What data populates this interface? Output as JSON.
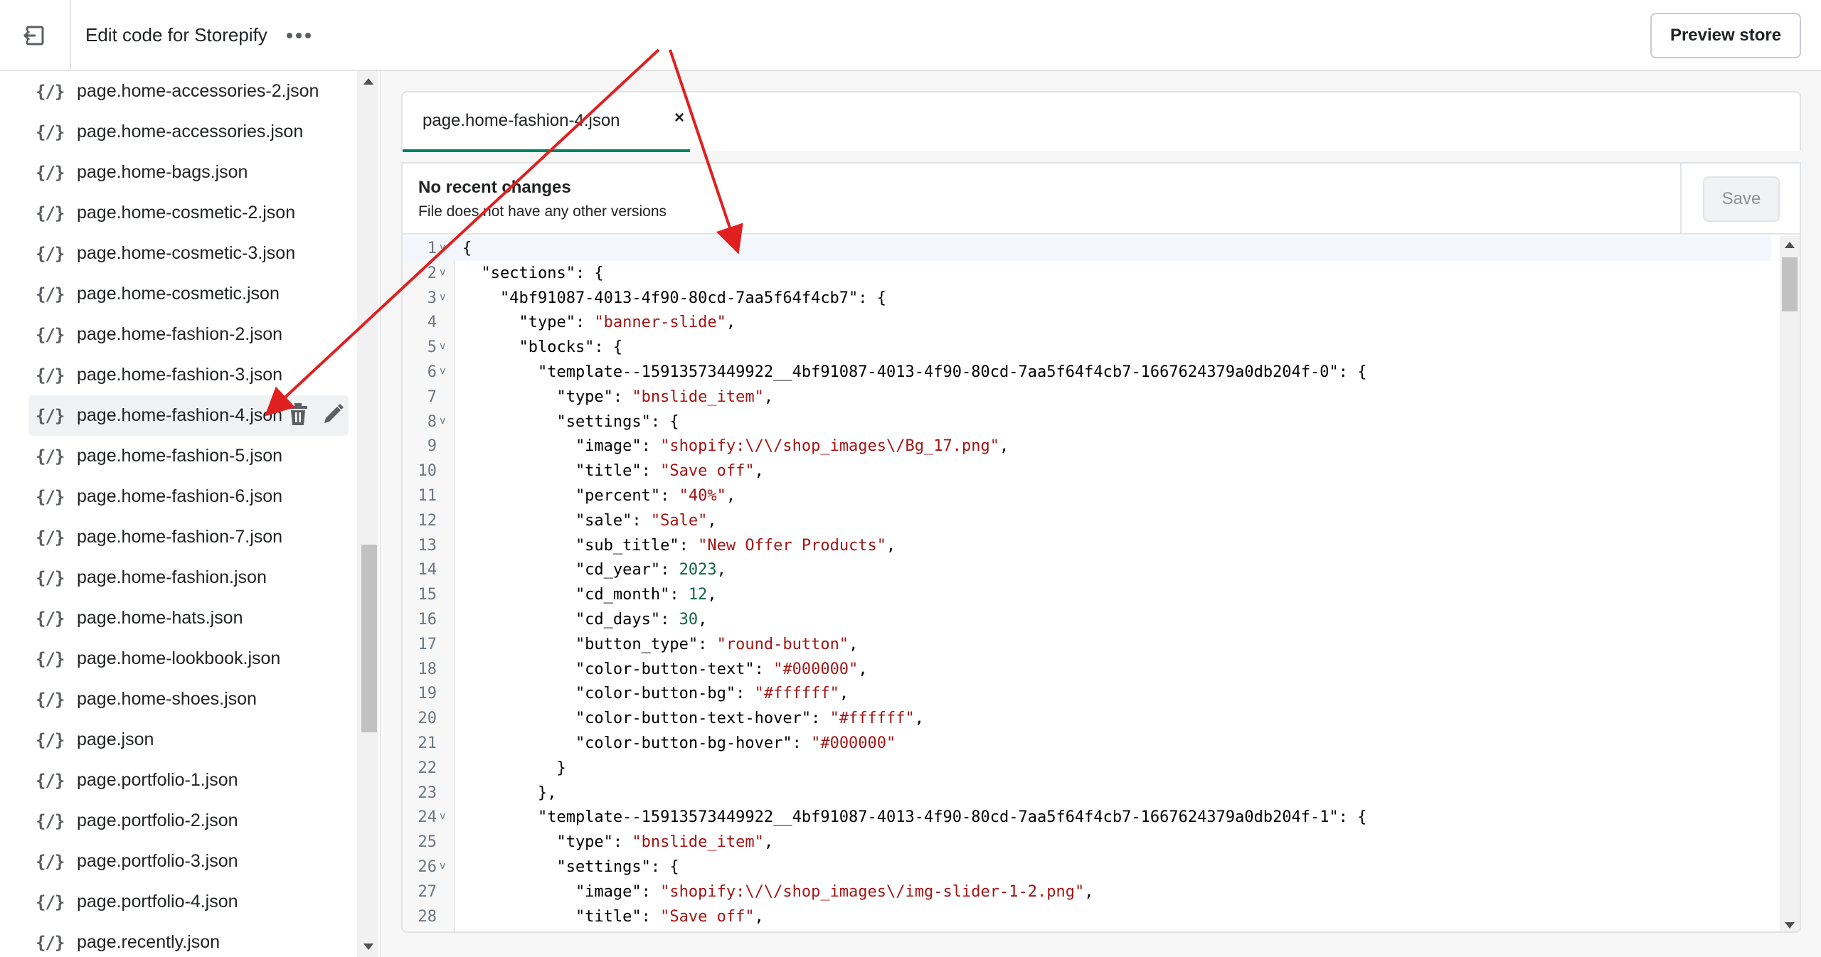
{
  "header": {
    "title": "Edit code for Storepify",
    "preview_label": "Preview store"
  },
  "sidebar": {
    "json_icon": "{/}",
    "files": [
      {
        "name": "page.home-accessories-2.json"
      },
      {
        "name": "page.home-accessories.json"
      },
      {
        "name": "page.home-bags.json"
      },
      {
        "name": "page.home-cosmetic-2.json"
      },
      {
        "name": "page.home-cosmetic-3.json"
      },
      {
        "name": "page.home-cosmetic.json"
      },
      {
        "name": "page.home-fashion-2.json"
      },
      {
        "name": "page.home-fashion-3.json"
      },
      {
        "name": "page.home-fashion-4.json",
        "active": true
      },
      {
        "name": "page.home-fashion-5.json"
      },
      {
        "name": "page.home-fashion-6.json"
      },
      {
        "name": "page.home-fashion-7.json"
      },
      {
        "name": "page.home-fashion.json"
      },
      {
        "name": "page.home-hats.json"
      },
      {
        "name": "page.home-lookbook.json"
      },
      {
        "name": "page.home-shoes.json"
      },
      {
        "name": "page.json"
      },
      {
        "name": "page.portfolio-1.json"
      },
      {
        "name": "page.portfolio-2.json"
      },
      {
        "name": "page.portfolio-3.json"
      },
      {
        "name": "page.portfolio-4.json"
      },
      {
        "name": "page.recently.json"
      }
    ]
  },
  "editor": {
    "tab_label": "page.home-fashion-4.json",
    "tab_close": "×",
    "status_title": "No recent changes",
    "status_sub": "File does not have any other versions",
    "save_label": "Save",
    "lines": [
      {
        "n": "1",
        "fold": true,
        "tokens": [
          [
            "k",
            "{"
          ]
        ]
      },
      {
        "n": "2",
        "fold": true,
        "tokens": [
          [
            "k",
            "  \"sections\": {"
          ]
        ]
      },
      {
        "n": "3",
        "fold": true,
        "tokens": [
          [
            "k",
            "    \"4bf91087-4013-4f90-80cd-7aa5f64f4cb7\": {"
          ]
        ]
      },
      {
        "n": "4",
        "fold": false,
        "tokens": [
          [
            "k",
            "      \"type\": "
          ],
          [
            "s",
            "\"banner-slide\""
          ],
          [
            "k",
            ","
          ]
        ]
      },
      {
        "n": "5",
        "fold": true,
        "tokens": [
          [
            "k",
            "      \"blocks\": {"
          ]
        ]
      },
      {
        "n": "6",
        "fold": true,
        "tokens": [
          [
            "k",
            "        \"template--15913573449922__4bf91087-4013-4f90-80cd-7aa5f64f4cb7-1667624379a0db204f-0\": {"
          ]
        ]
      },
      {
        "n": "7",
        "fold": false,
        "tokens": [
          [
            "k",
            "          \"type\": "
          ],
          [
            "s",
            "\"bnslide_item\""
          ],
          [
            "k",
            ","
          ]
        ]
      },
      {
        "n": "8",
        "fold": true,
        "tokens": [
          [
            "k",
            "          \"settings\": {"
          ]
        ]
      },
      {
        "n": "9",
        "fold": false,
        "tokens": [
          [
            "k",
            "            \"image\": "
          ],
          [
            "s",
            "\"shopify:\\/\\/shop_images\\/Bg_17.png\""
          ],
          [
            "k",
            ","
          ]
        ]
      },
      {
        "n": "10",
        "fold": false,
        "tokens": [
          [
            "k",
            "            \"title\": "
          ],
          [
            "s",
            "\"Save off\""
          ],
          [
            "k",
            ","
          ]
        ]
      },
      {
        "n": "11",
        "fold": false,
        "tokens": [
          [
            "k",
            "            \"percent\": "
          ],
          [
            "s",
            "\"40%\""
          ],
          [
            "k",
            ","
          ]
        ]
      },
      {
        "n": "12",
        "fold": false,
        "tokens": [
          [
            "k",
            "            \"sale\": "
          ],
          [
            "s",
            "\"Sale\""
          ],
          [
            "k",
            ","
          ]
        ]
      },
      {
        "n": "13",
        "fold": false,
        "tokens": [
          [
            "k",
            "            \"sub_title\": "
          ],
          [
            "s",
            "\"New Offer Products\""
          ],
          [
            "k",
            ","
          ]
        ]
      },
      {
        "n": "14",
        "fold": false,
        "tokens": [
          [
            "k",
            "            \"cd_year\": "
          ],
          [
            "n",
            "2023"
          ],
          [
            "k",
            ","
          ]
        ]
      },
      {
        "n": "15",
        "fold": false,
        "tokens": [
          [
            "k",
            "            \"cd_month\": "
          ],
          [
            "n",
            "12"
          ],
          [
            "k",
            ","
          ]
        ]
      },
      {
        "n": "16",
        "fold": false,
        "tokens": [
          [
            "k",
            "            \"cd_days\": "
          ],
          [
            "n",
            "30"
          ],
          [
            "k",
            ","
          ]
        ]
      },
      {
        "n": "17",
        "fold": false,
        "tokens": [
          [
            "k",
            "            \"button_type\": "
          ],
          [
            "s",
            "\"round-button\""
          ],
          [
            "k",
            ","
          ]
        ]
      },
      {
        "n": "18",
        "fold": false,
        "tokens": [
          [
            "k",
            "            \"color-button-text\": "
          ],
          [
            "s",
            "\"#000000\""
          ],
          [
            "k",
            ","
          ]
        ]
      },
      {
        "n": "19",
        "fold": false,
        "tokens": [
          [
            "k",
            "            \"color-button-bg\": "
          ],
          [
            "s",
            "\"#ffffff\""
          ],
          [
            "k",
            ","
          ]
        ]
      },
      {
        "n": "20",
        "fold": false,
        "tokens": [
          [
            "k",
            "            \"color-button-text-hover\": "
          ],
          [
            "s",
            "\"#ffffff\""
          ],
          [
            "k",
            ","
          ]
        ]
      },
      {
        "n": "21",
        "fold": false,
        "tokens": [
          [
            "k",
            "            \"color-button-bg-hover\": "
          ],
          [
            "s",
            "\"#000000\""
          ]
        ]
      },
      {
        "n": "22",
        "fold": false,
        "tokens": [
          [
            "k",
            "          }"
          ]
        ]
      },
      {
        "n": "23",
        "fold": false,
        "tokens": [
          [
            "k",
            "        },"
          ]
        ]
      },
      {
        "n": "24",
        "fold": true,
        "tokens": [
          [
            "k",
            "        \"template--15913573449922__4bf91087-4013-4f90-80cd-7aa5f64f4cb7-1667624379a0db204f-1\": {"
          ]
        ]
      },
      {
        "n": "25",
        "fold": false,
        "tokens": [
          [
            "k",
            "          \"type\": "
          ],
          [
            "s",
            "\"bnslide_item\""
          ],
          [
            "k",
            ","
          ]
        ]
      },
      {
        "n": "26",
        "fold": true,
        "tokens": [
          [
            "k",
            "          \"settings\": {"
          ]
        ]
      },
      {
        "n": "27",
        "fold": false,
        "tokens": [
          [
            "k",
            "            \"image\": "
          ],
          [
            "s",
            "\"shopify:\\/\\/shop_images\\/img-slider-1-2.png\""
          ],
          [
            "k",
            ","
          ]
        ]
      },
      {
        "n": "28",
        "fold": false,
        "tokens": [
          [
            "k",
            "            \"title\": "
          ],
          [
            "s",
            "\"Save off\""
          ],
          [
            "k",
            ","
          ]
        ]
      }
    ]
  },
  "colors": {
    "accent": "#008060",
    "annotation_arrow": "#e02020",
    "string": "#a31515",
    "number": "#116644"
  },
  "icons": {
    "exit": "exit-icon",
    "more": "more-horizontal-icon",
    "delete": "trash-icon",
    "rename": "pencil-icon",
    "fold": "chevron-down-icon"
  }
}
